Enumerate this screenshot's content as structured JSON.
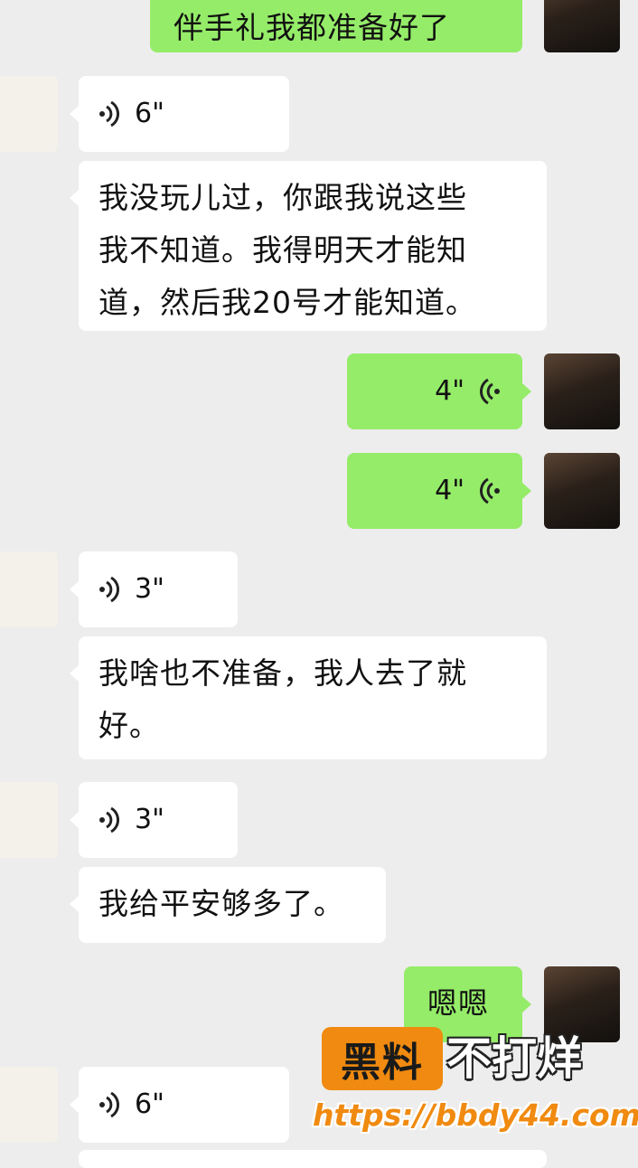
{
  "messages": [
    {
      "side": "me",
      "kind": "text",
      "text": "伴手礼我都准备好了"
    },
    {
      "side": "them",
      "kind": "voice",
      "duration": "6\""
    },
    {
      "side": "them",
      "kind": "text",
      "lines": [
        "我没玩儿过，你跟我说这些",
        "我不知道。我得明天才能知",
        "道，然后我20号才能知道。"
      ]
    },
    {
      "side": "me",
      "kind": "voice",
      "duration": "4\""
    },
    {
      "side": "me",
      "kind": "voice",
      "duration": "4\""
    },
    {
      "side": "them",
      "kind": "voice",
      "duration": "3\""
    },
    {
      "side": "them",
      "kind": "text",
      "lines": [
        "我啥也不准备，我人去了就",
        "好。"
      ]
    },
    {
      "side": "them",
      "kind": "voice",
      "duration": "3\""
    },
    {
      "side": "them",
      "kind": "text",
      "text": "我给平安够多了。"
    },
    {
      "side": "me",
      "kind": "text",
      "text": "嗯嗯"
    },
    {
      "side": "them",
      "kind": "voice",
      "duration": "6\""
    }
  ],
  "avatars": {
    "me": "man-in-trench-coat-photo",
    "them": "cartoon-sketch-avatar"
  },
  "icons": {
    "voice": "voice-wave-icon"
  },
  "watermark": {
    "badge": "黑料",
    "text": "不打烊",
    "url": "https://bbdy44.com"
  },
  "colors": {
    "background": "#ededed",
    "my_bubble": "#95ec69",
    "their_bubble": "#ffffff",
    "watermark_orange": "#f08a10"
  }
}
